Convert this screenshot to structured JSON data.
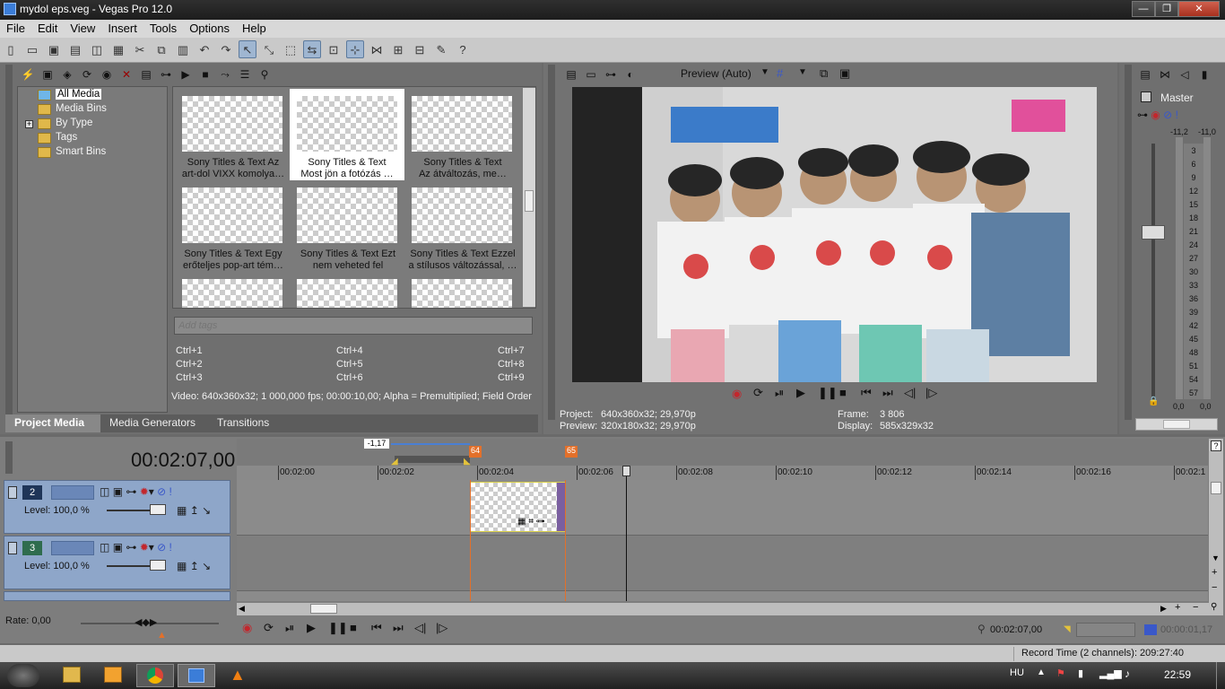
{
  "window": {
    "title": "mydol eps.veg - Vegas Pro 12.0",
    "min": "—",
    "max": "❐",
    "close": "✕"
  },
  "menu": [
    "File",
    "Edit",
    "View",
    "Insert",
    "Tools",
    "Options",
    "Help"
  ],
  "media_tree": {
    "items": [
      {
        "label": "All Media",
        "selected": true
      },
      {
        "label": "Media Bins"
      },
      {
        "label": "By Type",
        "expander": "+"
      },
      {
        "label": "Tags"
      },
      {
        "label": "Smart Bins"
      }
    ]
  },
  "thumbnails": [
    {
      "line1": "Sony Titles & Text Az",
      "line2": "art-dol VIXX komolya…"
    },
    {
      "line1": "Sony Titles & Text",
      "line2": "Most jön a fotózás …",
      "selected": true
    },
    {
      "line1": "Sony Titles & Text",
      "line2": "Az átváltozás, me…"
    },
    {
      "line1": "Sony Titles & Text Egy",
      "line2": "erőteljes pop-art tém…"
    },
    {
      "line1": "Sony Titles & Text Ezt",
      "line2": "nem veheted fel"
    },
    {
      "line1": "Sony Titles & Text Ezzel",
      "line2": "a stílusos változással, …"
    }
  ],
  "tags": {
    "placeholder": "Add tags"
  },
  "shortcuts": [
    "Ctrl+1",
    "Ctrl+4",
    "Ctrl+7",
    "Ctrl+2",
    "Ctrl+5",
    "Ctrl+8",
    "Ctrl+3",
    "Ctrl+6",
    "Ctrl+9"
  ],
  "media_info": "Video: 640x360x32; 1 000,000 fps; 00:00:10,00; Alpha = Premultiplied; Field Order",
  "tabs": [
    "Project Media",
    "Media Generators",
    "Transitions"
  ],
  "preview": {
    "mode": "Preview (Auto)",
    "project_label": "Project:",
    "project": "640x360x32; 29,970p",
    "preview_label": "Preview:",
    "preview_val": "320x180x32; 29,970p",
    "frame_label": "Frame:",
    "frame": "3 806",
    "display_label": "Display:",
    "display": "585x329x32"
  },
  "master": {
    "label": "Master",
    "left_peak": "-11,2",
    "right_peak": "-11,0",
    "scale": [
      "3",
      "6",
      "9",
      "12",
      "15",
      "18",
      "21",
      "24",
      "27",
      "30",
      "33",
      "36",
      "39",
      "42",
      "45",
      "48",
      "51",
      "54",
      "57"
    ],
    "bottom_left": "0,0",
    "bottom_right": "0,0"
  },
  "timeline": {
    "timecode": "00:02:07,00",
    "loop_length": "-1,17",
    "markers": [
      "64",
      "65"
    ],
    "ruler": [
      "00:02:00",
      "00:02:02",
      "00:02:04",
      "00:02:06",
      "00:02:08",
      "00:02:10",
      "00:02:12",
      "00:02:14",
      "00:02:16",
      "00:02:1"
    ],
    "tracks": [
      {
        "number": "2",
        "level": "Level: 100,0 %"
      },
      {
        "number": "3",
        "level": "Level: 100,0 %"
      }
    ],
    "rate": "Rate: 0,00",
    "cursor_time": "00:02:07,00",
    "selection_length": "00:00:01,17",
    "record_time": "Record Time (2 channels): 209:27:40"
  },
  "taskbar": {
    "lang": "HU",
    "clock": "22:59"
  }
}
